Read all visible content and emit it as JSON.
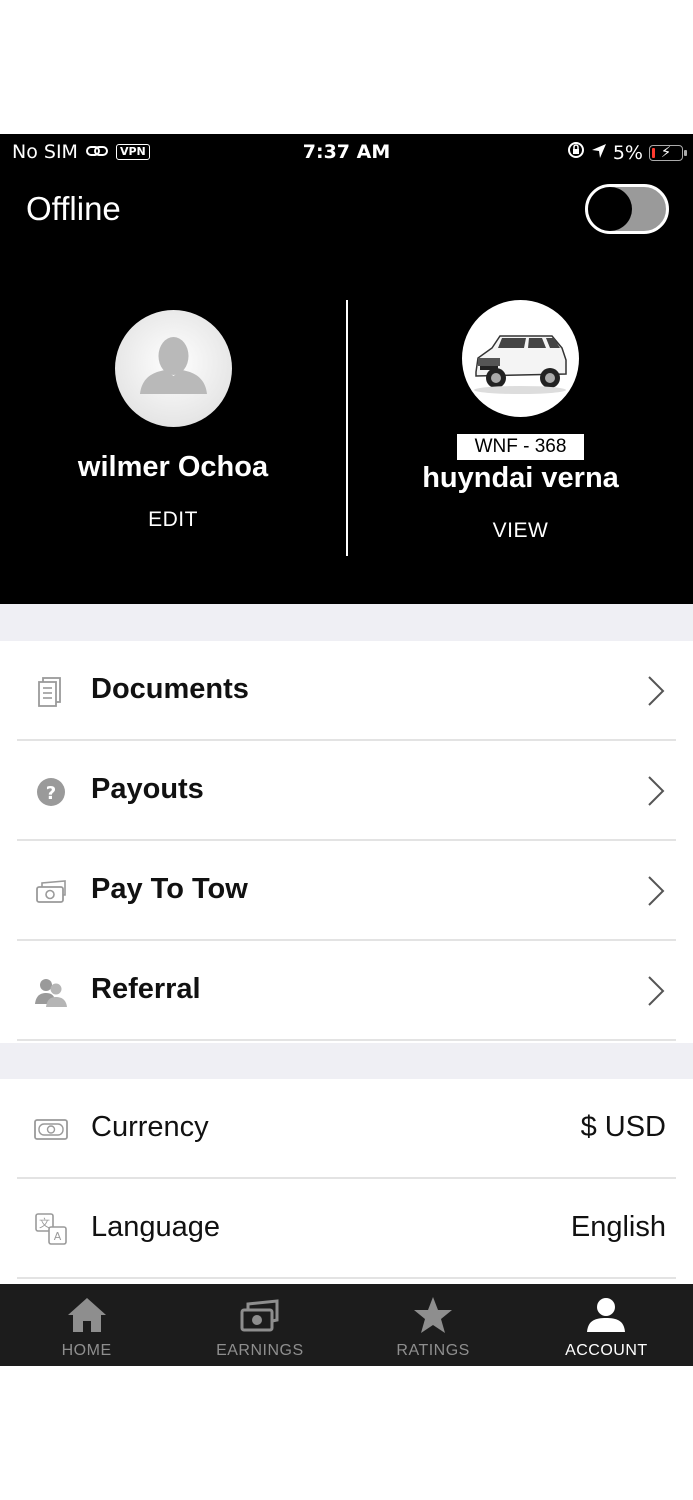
{
  "status_bar": {
    "carrier": "No SIM",
    "vpn": "VPN",
    "time": "7:37 AM",
    "battery_percent": "5%",
    "battery_level": 0.05
  },
  "header": {
    "status_label": "Offline",
    "online_toggle_on": false,
    "driver": {
      "name": "wilmer Ochoa",
      "action": "EDIT"
    },
    "vehicle": {
      "plate": "WNF - 368",
      "name": "huyndai verna",
      "action": "VIEW"
    }
  },
  "menu": [
    {
      "label": "Documents",
      "icon": "documents-icon"
    },
    {
      "label": "Payouts",
      "icon": "payouts-icon"
    },
    {
      "label": "Pay To Tow",
      "icon": "cash-icon"
    },
    {
      "label": "Referral",
      "icon": "referral-icon"
    }
  ],
  "settings": [
    {
      "label": "Currency",
      "value": "$ USD",
      "icon": "currency-icon"
    },
    {
      "label": "Language",
      "value": "English",
      "icon": "language-icon"
    }
  ],
  "bottom_nav": [
    {
      "label": "HOME",
      "icon": "home-icon",
      "active": false
    },
    {
      "label": "EARNINGS",
      "icon": "earnings-icon",
      "active": false
    },
    {
      "label": "RATINGS",
      "icon": "star-icon",
      "active": false
    },
    {
      "label": "ACCOUNT",
      "icon": "account-icon",
      "active": true
    }
  ],
  "colors": {
    "header_bg": "#000000",
    "section_gap": "#efeff4",
    "nav_bg": "#1c1c1c",
    "battery_low": "#ff3b30"
  }
}
